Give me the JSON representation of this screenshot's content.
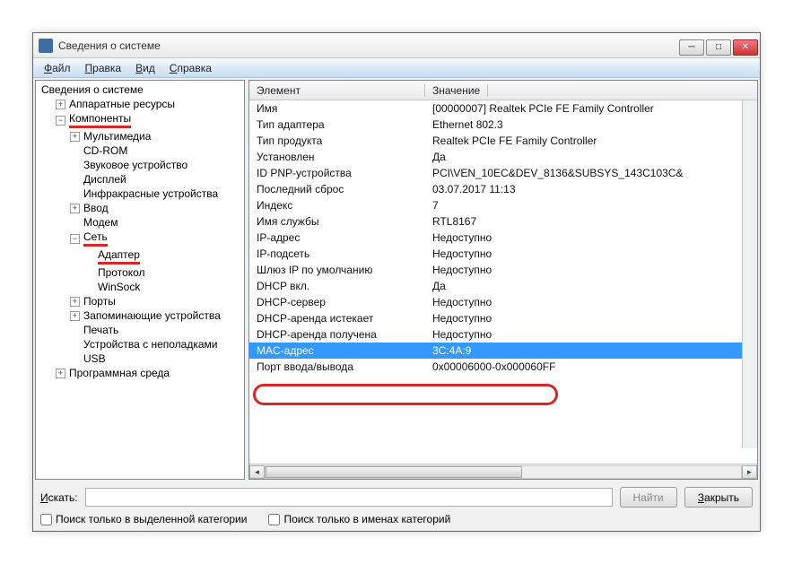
{
  "window": {
    "title": "Сведения о системе"
  },
  "menu": {
    "file": "Файл",
    "edit": "Правка",
    "view": "Вид",
    "help": "Справка"
  },
  "tree": {
    "root": "Сведения о системе",
    "hw": "Аппаратные ресурсы",
    "comp": "Компоненты",
    "mm": "Мультимедиа",
    "cdrom": "CD-ROM",
    "sound": "Звуковое устройство",
    "display": "Дисплей",
    "ir": "Инфракрасные устройства",
    "input": "Ввод",
    "modem": "Модем",
    "net": "Сеть",
    "adapter": "Адаптер",
    "protocol": "Протокол",
    "winsock": "WinSock",
    "ports": "Порты",
    "storage": "Запоминающие устройства",
    "print": "Печать",
    "problem": "Устройства с неполадками",
    "usb": "USB",
    "swenv": "Программная среда"
  },
  "headers": {
    "element": "Элемент",
    "value": "Значение"
  },
  "rows": [
    {
      "k": "Имя",
      "v": "[00000007] Realtek PCIe FE Family Controller"
    },
    {
      "k": "Тип адаптера",
      "v": "Ethernet 802.3"
    },
    {
      "k": "Тип продукта",
      "v": "Realtek PCIe FE Family Controller"
    },
    {
      "k": "Установлен",
      "v": "Да"
    },
    {
      "k": "ID PNP-устройства",
      "v": "PCI\\VEN_10EC&DEV_8136&SUBSYS_143C103C&"
    },
    {
      "k": "Последний сброс",
      "v": "03.07.2017 11:13"
    },
    {
      "k": "Индекс",
      "v": "7"
    },
    {
      "k": "Имя службы",
      "v": "RTL8167"
    },
    {
      "k": "IP-адрес",
      "v": "Недоступно"
    },
    {
      "k": "IP-подсеть",
      "v": "Недоступно"
    },
    {
      "k": "Шлюз IP по умолчанию",
      "v": "Недоступно"
    },
    {
      "k": "DHCP вкл.",
      "v": "Да"
    },
    {
      "k": "DHCP-сервер",
      "v": "Недоступно"
    },
    {
      "k": "DHCP-аренда истекает",
      "v": "Недоступно"
    },
    {
      "k": "DHCP-аренда получена",
      "v": "Недоступно"
    },
    {
      "k": "MAC-адрес",
      "v": "3C:4A:9"
    },
    {
      "k": "Порт ввода/вывода",
      "v": "0x00006000-0x000060FF"
    }
  ],
  "search": {
    "label": "Искать:",
    "find": "Найти",
    "close": "Закрыть",
    "chk1": "Поиск только в выделенной категории",
    "chk2": "Поиск только в именах категорий"
  }
}
